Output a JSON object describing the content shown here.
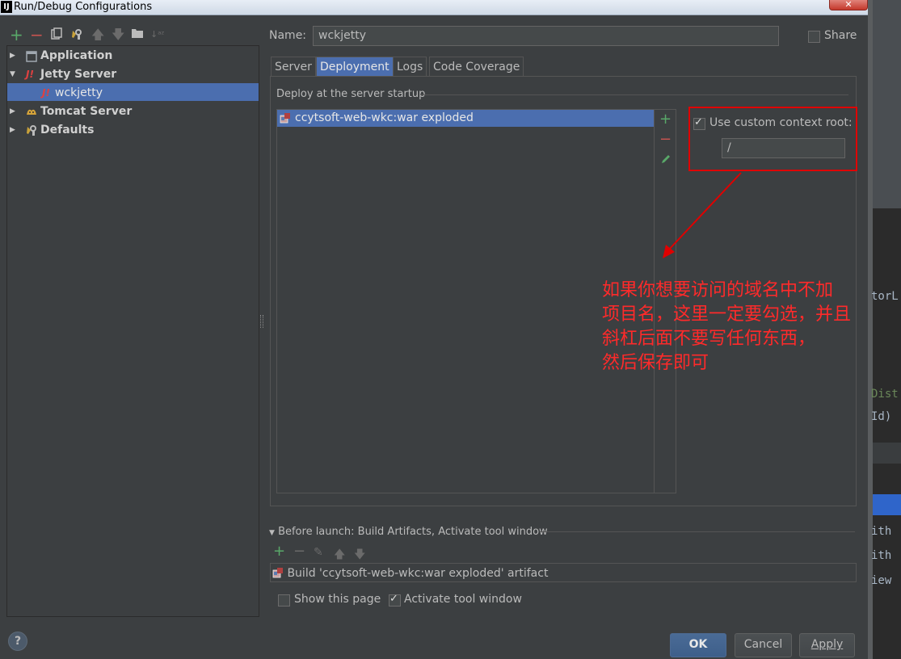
{
  "window": {
    "title": "Run/Debug Configurations",
    "app_logo": "IJ",
    "close_icon": "close-icon"
  },
  "toolbar": {
    "icons": [
      "add-icon",
      "remove-icon",
      "copy-icon",
      "edit-defaults-icon",
      "move-up-icon",
      "move-down-icon",
      "folder-icon",
      "sort-icon"
    ]
  },
  "tree": {
    "items": [
      {
        "label": "Application",
        "expanded": false,
        "icon": "application-icon"
      },
      {
        "label": "Jetty Server",
        "expanded": true,
        "icon": "jetty-icon"
      },
      {
        "label": "wckjetty",
        "selected": true,
        "icon": "jetty-icon"
      },
      {
        "label": "Tomcat Server",
        "expanded": false,
        "icon": "tomcat-icon"
      },
      {
        "label": "Defaults",
        "expanded": false,
        "icon": "wrench-icon"
      }
    ]
  },
  "config": {
    "name_label": "Name:",
    "name_value": "wckjetty",
    "share_label": "Share",
    "share_checked": false
  },
  "tabs": [
    {
      "label": "Server",
      "active": false
    },
    {
      "label": "Deployment",
      "active": true
    },
    {
      "label": "Logs",
      "active": false
    },
    {
      "label": "Code Coverage",
      "active": false
    }
  ],
  "deployment": {
    "section_label": "Deploy at the server startup",
    "artifacts": [
      "ccytsoft-web-wkc:war exploded"
    ],
    "use_custom_root_label": "Use custom context root:",
    "use_custom_root_checked": true,
    "context_root_value": "/"
  },
  "annotation": {
    "lines": [
      "如果你想要访问的域名中不加",
      "项目名，这里一定要勾选，并且",
      "斜杠后面不要写任何东西，",
      "然后保存即可"
    ],
    "color": "#ff2a2a"
  },
  "before_launch": {
    "label": "Before launch: Build Artifacts, Activate tool window",
    "tasks": [
      "Build 'ccytsoft-web-wkc:war exploded' artifact"
    ],
    "show_page_label": "Show this page",
    "show_page_checked": false,
    "activate_label": "Activate tool window",
    "activate_checked": true
  },
  "buttons": {
    "ok": "OK",
    "cancel": "Cancel",
    "apply": "Apply",
    "help": "?"
  },
  "background_code": [
    "torL",
    "Dist",
    "Id)",
    "ith",
    "ith",
    "iew"
  ],
  "colors": {
    "selection": "#4b6eaf",
    "panel": "#3c3f41",
    "annotation_border": "#e00000"
  }
}
